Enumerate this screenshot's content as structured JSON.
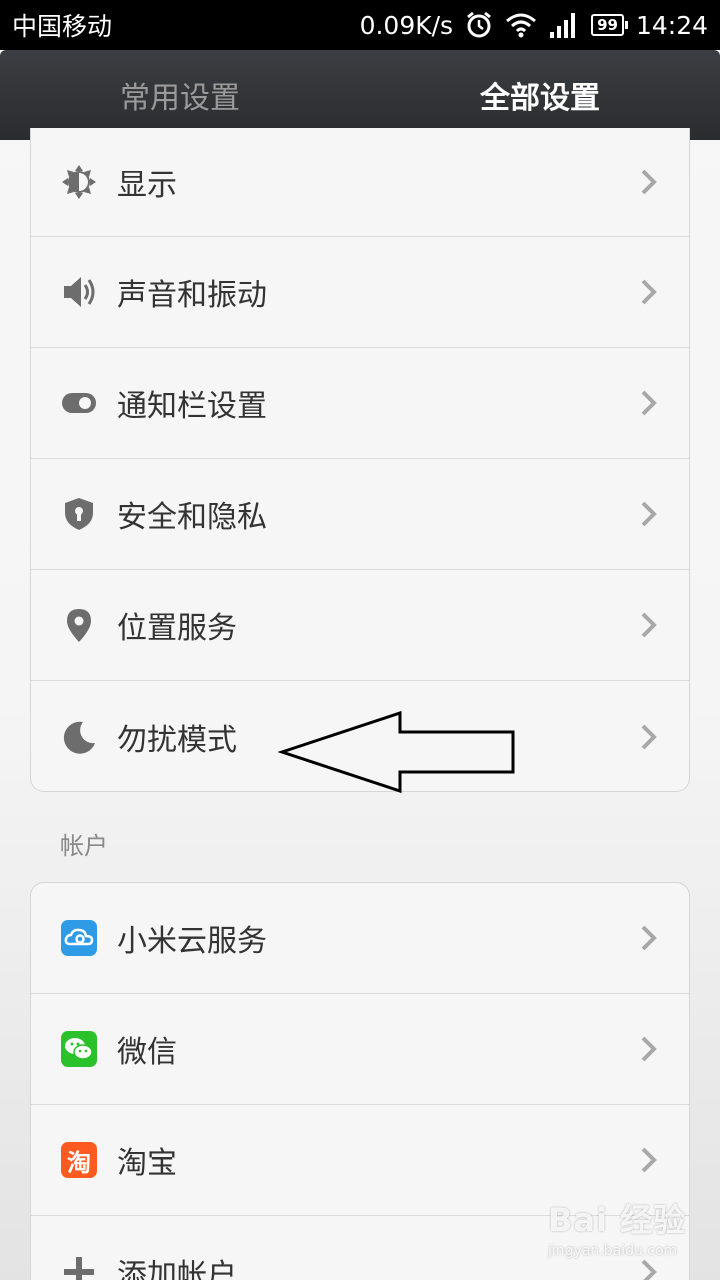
{
  "status_bar": {
    "carrier": "中国移动",
    "speed": "0.09K/s",
    "battery": "99",
    "time": "14:24",
    "icons": [
      "alarm-icon",
      "wifi-icon",
      "signal-icon",
      "battery-icon"
    ]
  },
  "tabs": [
    {
      "label": "常用设置",
      "active": false
    },
    {
      "label": "全部设置",
      "active": true
    }
  ],
  "settings_group": {
    "items": [
      {
        "label": "显示",
        "icon": "brightness-icon"
      },
      {
        "label": "声音和振动",
        "icon": "speaker-icon"
      },
      {
        "label": "通知栏设置",
        "icon": "toggle-icon"
      },
      {
        "label": "安全和隐私",
        "icon": "shield-icon"
      },
      {
        "label": "位置服务",
        "icon": "location-pin-icon"
      },
      {
        "label": "勿扰模式",
        "icon": "moon-icon"
      }
    ]
  },
  "account_section": {
    "title": "帐户",
    "items": [
      {
        "label": "小米云服务",
        "icon": "cloud-icon",
        "color": "#2f9be6"
      },
      {
        "label": "微信",
        "icon": "wechat-icon",
        "color": "#2bc12b"
      },
      {
        "label": "淘宝",
        "icon": "taobao-icon",
        "color": "#ff5a1f",
        "glyph": "淘"
      },
      {
        "label": "添加帐户",
        "icon": "plus-icon"
      }
    ]
  },
  "watermark": {
    "brand": "Bai 经验",
    "url": "jingyan.baidu.com"
  },
  "colors": {
    "tab_bar": "#2d2f33",
    "icon_gray": "#6d6d6d",
    "chevron": "#a8a8a8"
  }
}
